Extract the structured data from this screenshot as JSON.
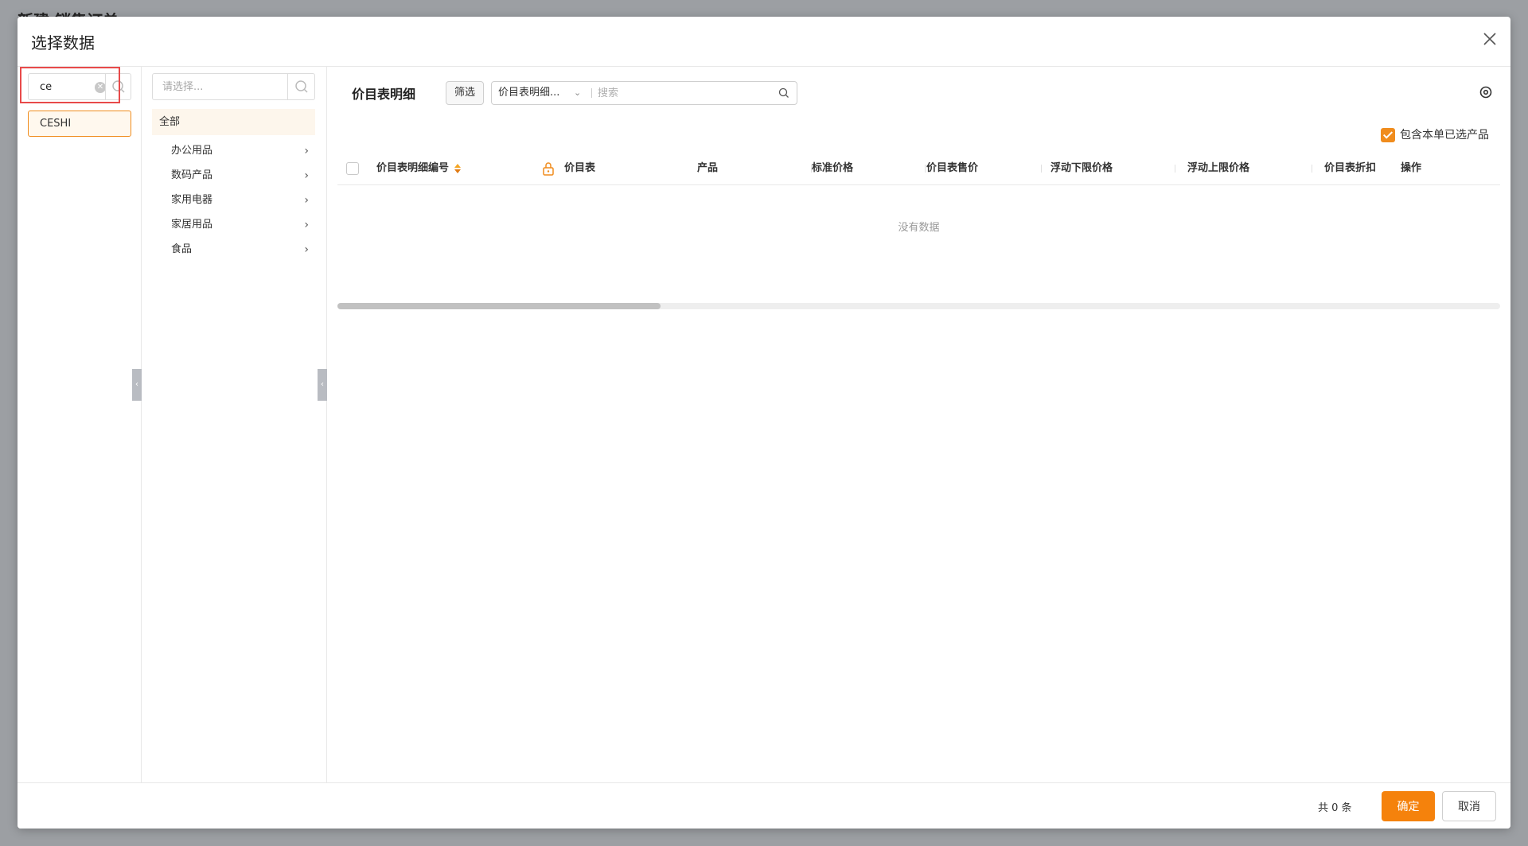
{
  "background": {
    "page_title": "新建 销售订单",
    "buttons": [
      "",
      "",
      "",
      "",
      ""
    ]
  },
  "modal": {
    "title": "选择数据"
  },
  "left_panel": {
    "search_value": "ce",
    "items": [
      {
        "label": "CESHI"
      }
    ]
  },
  "category_panel": {
    "search_placeholder": "请选择...",
    "all_label": "全部",
    "items": [
      {
        "label": "办公用品"
      },
      {
        "label": "数码产品"
      },
      {
        "label": "家用电器"
      },
      {
        "label": "家居用品"
      },
      {
        "label": "食品"
      }
    ]
  },
  "main": {
    "title": "价目表明细",
    "filter_label": "筛选",
    "search_field": "价目表明细...",
    "search_placeholder": "搜索",
    "include_selected_label": "包含本单已选产品",
    "columns": [
      "价目表明细编号",
      "价目表",
      "产品",
      "标准价格",
      "价目表售价",
      "浮动下限价格",
      "浮动上限价格",
      "价目表折扣",
      "操作"
    ],
    "empty_text": "没有数据"
  },
  "footer": {
    "total_text": "共 0 条",
    "ok_label": "确定",
    "cancel_label": "取消"
  },
  "colors": {
    "accent": "#f5820c",
    "highlight": "#e84a4a"
  }
}
